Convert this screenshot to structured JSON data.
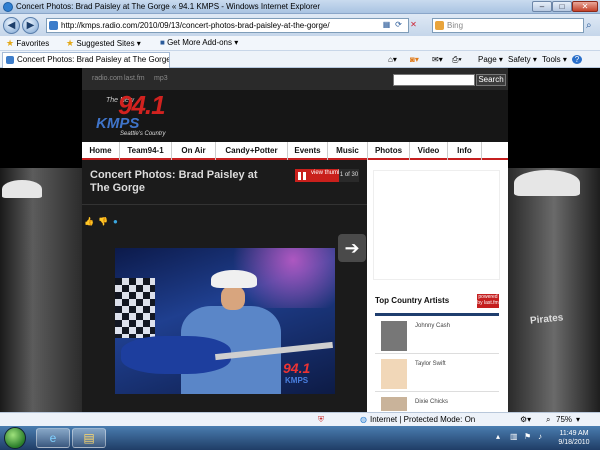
{
  "window": {
    "title": "Concert Photos: Brad Paisley at The Gorge « 94.1 KMPS - Windows Internet Explorer",
    "minimize": "–",
    "restore": "□",
    "close": "✕"
  },
  "addressbar": {
    "url": "http://kmps.radio.com/2010/09/13/concert-photos-brad-paisley-at-the-gorge/",
    "search_placeholder": "Bing"
  },
  "favorites_bar": {
    "favorites": "Favorites",
    "suggested_sites": "Suggested Sites ▾",
    "get_more_addons": "Get More Add-ons ▾"
  },
  "tab": {
    "title": "Concert Photos: Brad Paisley at The Gorge « 94.1 ..."
  },
  "command_bar": {
    "page": "Page ▾",
    "safety": "Safety ▾",
    "tools": "Tools ▾",
    "help": "?"
  },
  "site": {
    "top_logos": [
      "radio.com",
      "last.fm",
      "mp3"
    ],
    "search_button": "Search",
    "brand": {
      "new": "The New",
      "freq": "94.1",
      "name": "KMPS",
      "tagline": "Seattle's Country"
    },
    "nav": [
      "Home",
      "Team94-1",
      "On Air",
      "Candy+Potter",
      "Events",
      "Music",
      "Photos",
      "Video",
      "Info"
    ],
    "post_title": "Concert Photos: Brad Paisley at The Gorge",
    "thumbnails_button": "view thumbnails",
    "slide_count": "1 of 30",
    "photo_watermark": "94.1",
    "photo_watermark_sub": "KMPS",
    "sidebar": {
      "heading": "Top Country Artists",
      "powered_by": "powered by last.fm",
      "artists": [
        "Johnny Cash",
        "Taylor Swift",
        "Dixie Chicks"
      ]
    },
    "side_shirt_text": "Pirates"
  },
  "statusbar": {
    "zone": "Internet | Protected Mode: On",
    "zoom": "75%"
  },
  "taskbar": {
    "time": "11:49 AM",
    "date": "9/18/2010"
  }
}
